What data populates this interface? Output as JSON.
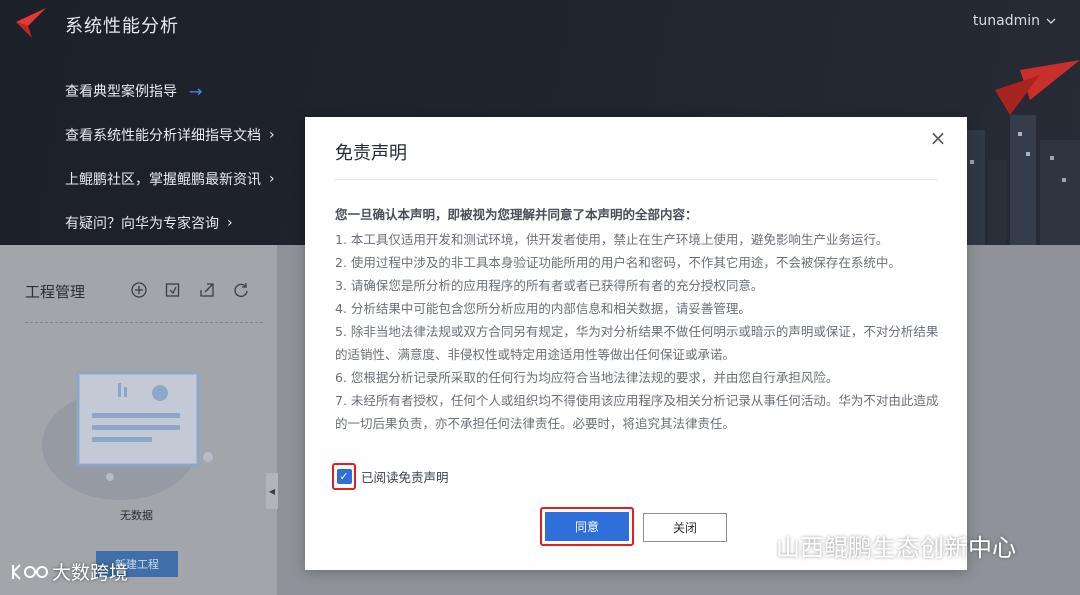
{
  "header": {
    "app_title": "系统性能分析",
    "user_name": "tunadmin",
    "user_menu_icon": "chevron-down-icon"
  },
  "hero_links": [
    {
      "label": "查看典型案例指导",
      "icon": "arrow-right-icon"
    },
    {
      "label": "查看系统性能分析详细指导文档",
      "icon": "chevron-right-icon"
    },
    {
      "label": "上鲲鹏社区，掌握鲲鹏最新资讯",
      "icon": "chevron-right-icon"
    },
    {
      "label": "有疑问？向华为专家咨询",
      "icon": "chevron-right-icon"
    }
  ],
  "project_panel": {
    "title": "工程管理",
    "tools": [
      "add-circle-icon",
      "import-icon",
      "export-icon",
      "refresh-icon"
    ],
    "empty_text": "无数据",
    "new_project_label": "新建工程"
  },
  "modal": {
    "title": "免责声明",
    "lead": "您一旦确认本声明，即被视为您理解并同意了本声明的全部内容：",
    "clauses": [
      "1. 本工具仅适用开发和测试环境，供开发者使用，禁止在生产环境上使用，避免影响生产业务运行。",
      "2. 使用过程中涉及的非工具本身验证功能所用的用户名和密码，不作其它用途，不会被保存在系统中。",
      "3. 请确保您是所分析的应用程序的所有者或者已获得所有者的充分授权同意。",
      "4. 分析结果中可能包含您所分析应用的内部信息和相关数据，请妥善管理。",
      "5. 除非当地法律法规或双方合同另有规定，华为对分析结果不做任何明示或暗示的声明或保证，不对分析结果的适销性、满意度、非侵权性或特定用途适用性等做出任何保证或承诺。",
      "6. 您根据分析记录所采取的任何行为均应符合当地法律法规的要求，并由您自行承担风险。",
      "7. 未经所有者授权，任何个人或组织均不得使用该应用程序及相关分析记录从事任何活动。华为不对由此造成的一切后果负责，亦不承担任何法律责任。必要时，将追究其法律责任。"
    ],
    "agree_label": "已阅读免责声明",
    "agree_checked": true,
    "confirm_label": "同意",
    "close_label": "关闭"
  },
  "watermarks": {
    "left": "大数跨境",
    "right": "山西鲲鹏生态创新中心"
  },
  "colors": {
    "primary": "#2f6fd9",
    "highlight_border": "#e02020",
    "header_bg": "#1c2029"
  }
}
